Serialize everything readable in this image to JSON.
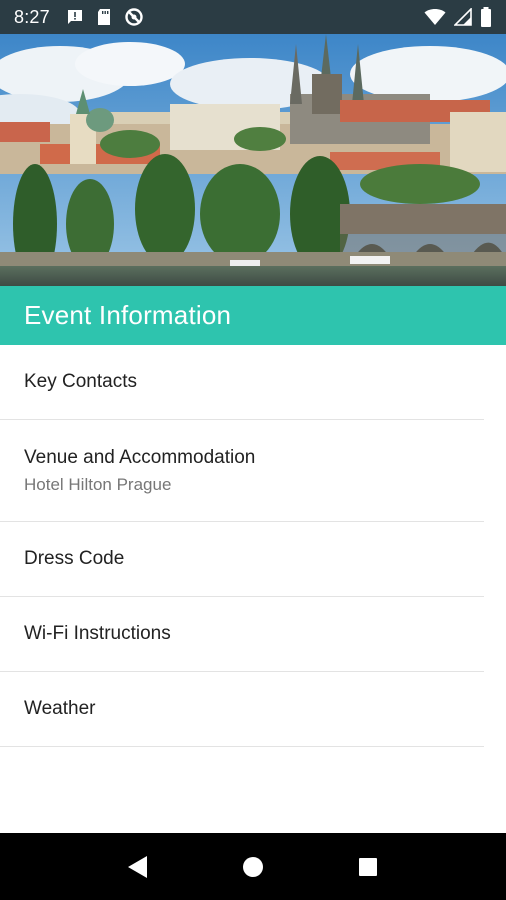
{
  "status_bar": {
    "time": "8:27",
    "left_icons": [
      "message-notification-icon",
      "sd-card-icon",
      "blocked-icon"
    ],
    "right_icons": [
      "wifi-icon",
      "cellular-signal-icon",
      "battery-icon"
    ]
  },
  "hero": {
    "image": "prague-castle-photo"
  },
  "header": {
    "title": "Event Information",
    "color": "#2ec4ae"
  },
  "menu": {
    "items": [
      {
        "title": "Key Contacts",
        "subtitle": ""
      },
      {
        "title": "Venue and Accommodation",
        "subtitle": "Hotel Hilton Prague"
      },
      {
        "title": "Dress Code",
        "subtitle": ""
      },
      {
        "title": "Wi-Fi Instructions",
        "subtitle": ""
      },
      {
        "title": "Weather",
        "subtitle": ""
      }
    ]
  },
  "nav_bar": {
    "buttons": [
      "back-icon",
      "home-icon",
      "recents-icon"
    ]
  }
}
